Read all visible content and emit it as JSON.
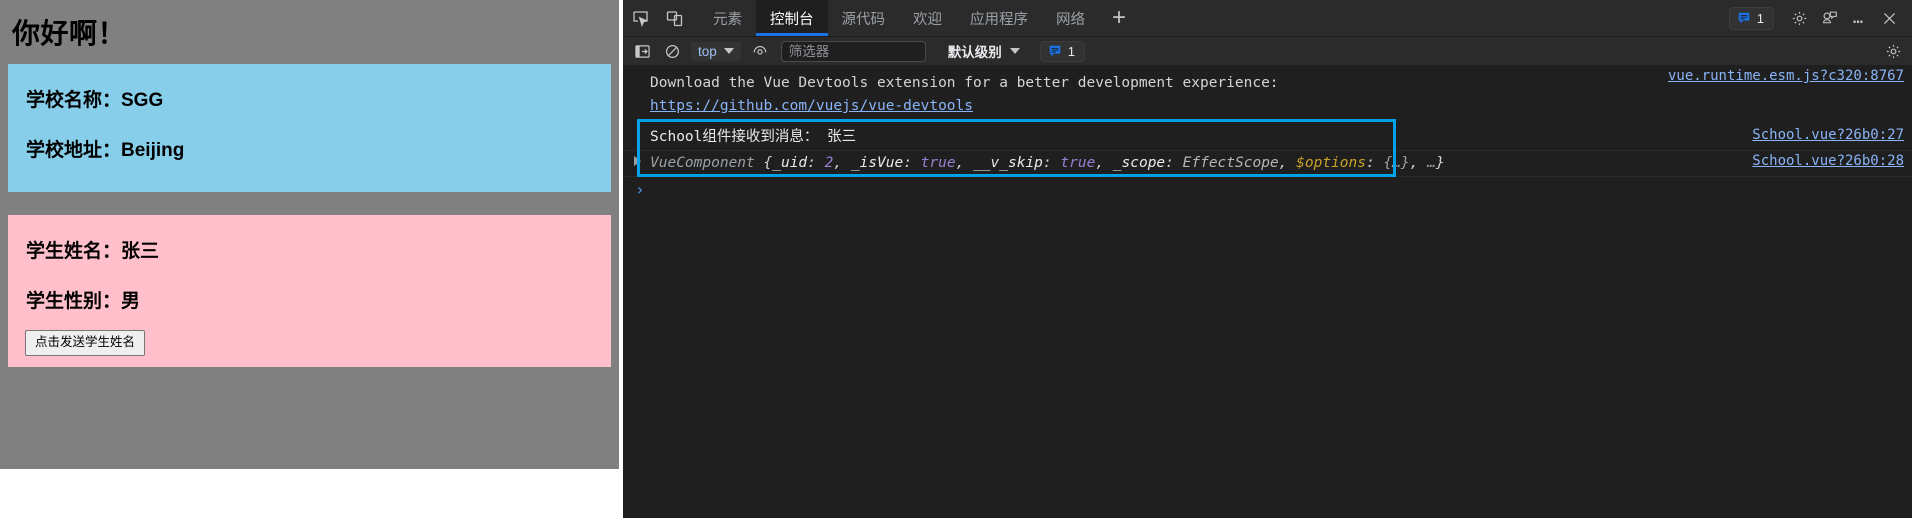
{
  "page": {
    "greeting": "你好啊！",
    "school_card": {
      "name_line": "学校名称：SGG",
      "address_line": "学校地址：Beijing",
      "bg_color": "#87ceeb"
    },
    "student_card": {
      "name_line": "学生姓名：张三",
      "gender_line": "学生性别：男",
      "button_label": "点击发送学生姓名",
      "bg_color": "#ffc0cb"
    },
    "bg_color": "#808080"
  },
  "devtools": {
    "tabs": [
      {
        "label": "元素",
        "active": false
      },
      {
        "label": "控制台",
        "active": true
      },
      {
        "label": "源代码",
        "active": false
      },
      {
        "label": "欢迎",
        "active": false
      },
      {
        "label": "应用程序",
        "active": false
      },
      {
        "label": "网络",
        "active": false
      }
    ],
    "add_tab_label": "+",
    "message_count": "1",
    "icons": {
      "inspect": "inspect-element-icon",
      "device": "device-toolbar-icon",
      "settings": "gear-icon",
      "feedback": "feedback-icon",
      "more": "…",
      "close": "close-icon"
    },
    "filterbar": {
      "sidebar_toggle": "console-sidebar-icon",
      "clear": "clear-console-icon",
      "context": "top",
      "eye": "live-expression-icon",
      "filter_placeholder": "筛选器",
      "filter_value": "",
      "level": "默认级别",
      "count": "1",
      "settings": "gear-icon"
    },
    "accent_color": "#1a73e8",
    "highlight_color": "#00a2e8"
  },
  "console": {
    "banner": {
      "line1": "Download the Vue Devtools extension for a better development experience:",
      "line2": "https://github.com/vuejs/vue-devtools",
      "source": "vue.runtime.esm.js?c320:8767"
    },
    "log": {
      "message": "School组件接收到消息： 张三",
      "source": "School.vue?26b0:27"
    },
    "object": {
      "constructor": "VueComponent",
      "open_brace": "{",
      "props": [
        {
          "key": "_uid",
          "sep": ": ",
          "value": "2",
          "kind": "num"
        },
        {
          "key": "_isVue",
          "sep": ": ",
          "value": "true",
          "kind": "bool"
        },
        {
          "key": "__v_skip",
          "sep": ": ",
          "value": "true",
          "kind": "bool"
        },
        {
          "key": "_scope",
          "sep": ": ",
          "value": "EffectScope",
          "kind": "cls"
        },
        {
          "key": "$options",
          "sep": ": ",
          "value": "{…}",
          "kind": "opt"
        }
      ],
      "ellipsis": "…",
      "close_brace": "}",
      "source": "School.vue?26b0:28"
    },
    "prompt_caret": "›"
  }
}
